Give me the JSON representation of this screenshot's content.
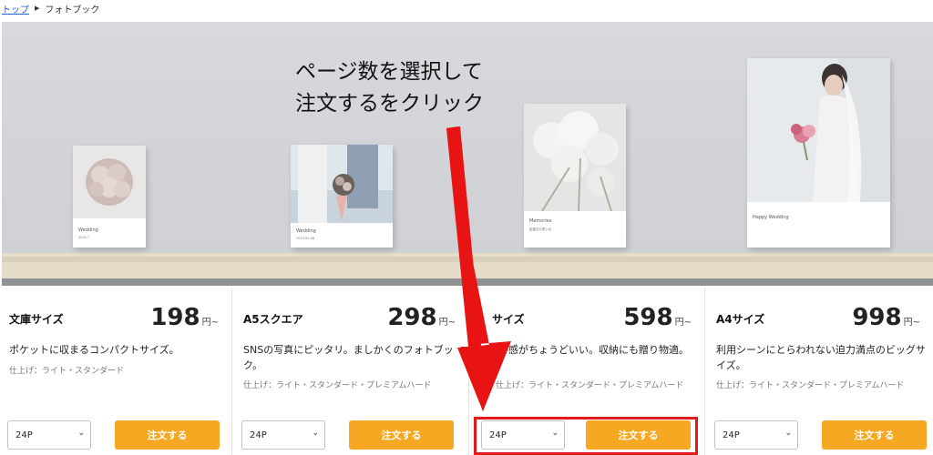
{
  "breadcrumb": {
    "home": "トップ",
    "separator": "▶",
    "current": "フォトブック"
  },
  "hero": {
    "annotation_line1": "ページ数を選択して",
    "annotation_line2": "注文するをクリック",
    "books": [
      {
        "caption": "Wedding",
        "sub": "2020.7"
      },
      {
        "caption": "Wedding",
        "sub": "2019.05.08"
      },
      {
        "caption": "Memories",
        "sub": "結婚式の思い出"
      },
      {
        "caption": "Happy Wedding",
        "sub": ""
      }
    ]
  },
  "products": [
    {
      "name": "文庫サイズ",
      "price": "198",
      "unit": "円~",
      "description": "ポケットに収まるコンパクトサイズ。",
      "finish": "仕上げ：ライト・スタンダード",
      "pages": "24P",
      "button": "注文する"
    },
    {
      "name": "A5スクエア",
      "price": "298",
      "unit": "円~",
      "description": "SNSの写真にピッタリ。ましかくのフォトブック。",
      "finish": "仕上げ：ライト・スタンダード・プレミアムハード",
      "pages": "24P",
      "button": "注文する"
    },
    {
      "name": "サイズ",
      "price": "598",
      "unit": "円~",
      "description": "感がちょうどいい。収納にも贈り物適。",
      "finish": "仕上げ：ライト・スタンダード・プレミアムハード",
      "pages": "24P",
      "button": "注文する"
    },
    {
      "name": "A4サイズ",
      "price": "998",
      "unit": "円~",
      "description": "利用シーンにとらわれない迫力満点のビッグサイズ。",
      "finish": "仕上げ：ライト・スタンダード・プレミアムハード",
      "pages": "24P",
      "button": "注文する"
    }
  ],
  "colors": {
    "order_button": "#f7a823",
    "annotation": "#e21a1a",
    "link": "#1a5fd0"
  }
}
